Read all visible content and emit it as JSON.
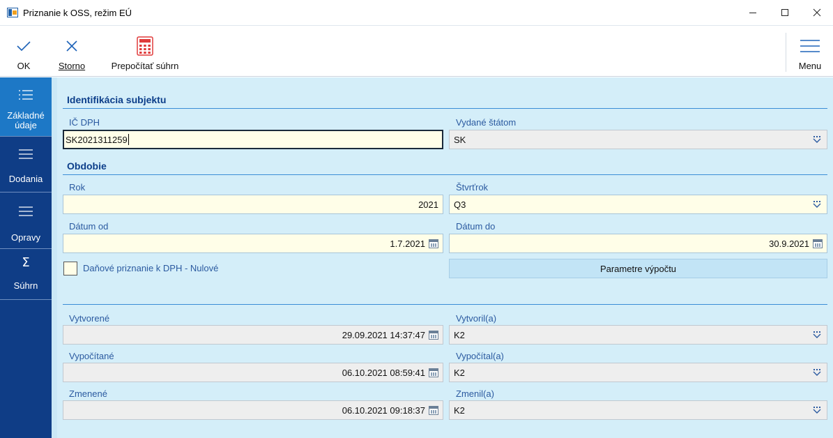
{
  "window": {
    "title": "Priznanie k OSS, režim EÚ"
  },
  "toolbar": {
    "ok_label": "OK",
    "storno_label": "Storno",
    "recalc_label": "Prepočítať súhrn",
    "menu_label": "Menu"
  },
  "nav": {
    "items": [
      {
        "label": "Základné údaje",
        "icon": "list-icon",
        "active": true
      },
      {
        "label": "Dodania",
        "icon": "list-icon",
        "active": false
      },
      {
        "label": "Opravy",
        "icon": "list-icon",
        "active": false
      },
      {
        "label": "Súhrn",
        "icon": "sigma-icon",
        "active": false
      }
    ]
  },
  "identification": {
    "title": "Identifikácia subjektu",
    "vat_id_label": "IČ DPH",
    "vat_id_value": "SK2021311259",
    "issued_by_label": "Vydané štátom",
    "issued_by_value": "SK"
  },
  "period": {
    "title": "Obdobie",
    "year_label": "Rok",
    "year_value": "2021",
    "quarter_label": "Štvrťrok",
    "quarter_value": "Q3",
    "date_from_label": "Dátum od",
    "date_from_value": "1.7.2021",
    "date_to_label": "Dátum do",
    "date_to_value": "30.9.2021",
    "zero_return_label": "Daňové priznanie k DPH - Nulové",
    "zero_return_checked": false,
    "params_button_label": "Parametre výpočtu"
  },
  "audit": {
    "created_label": "Vytvorené",
    "created_value": "29.09.2021 14:37:47",
    "created_by_label": "Vytvoril(a)",
    "created_by_value": "K2",
    "calculated_label": "Vypočítané",
    "calculated_value": "06.10.2021 08:59:41",
    "calculated_by_label": "Vypočítal(a)",
    "calculated_by_value": "K2",
    "changed_label": "Zmenené",
    "changed_value": "06.10.2021 09:18:37",
    "changed_by_label": "Zmenil(a)",
    "changed_by_value": "K2"
  },
  "colors": {
    "nav_bg": "#0f3d86",
    "nav_active": "#1d78c6",
    "content_bg": "#d4eef9",
    "field_bg": "#fffee8",
    "readonly_bg": "#eeeeee",
    "section_title": "#0c3e8a",
    "label": "#2b5aa0",
    "recalc_icon": "#e03b3b"
  }
}
